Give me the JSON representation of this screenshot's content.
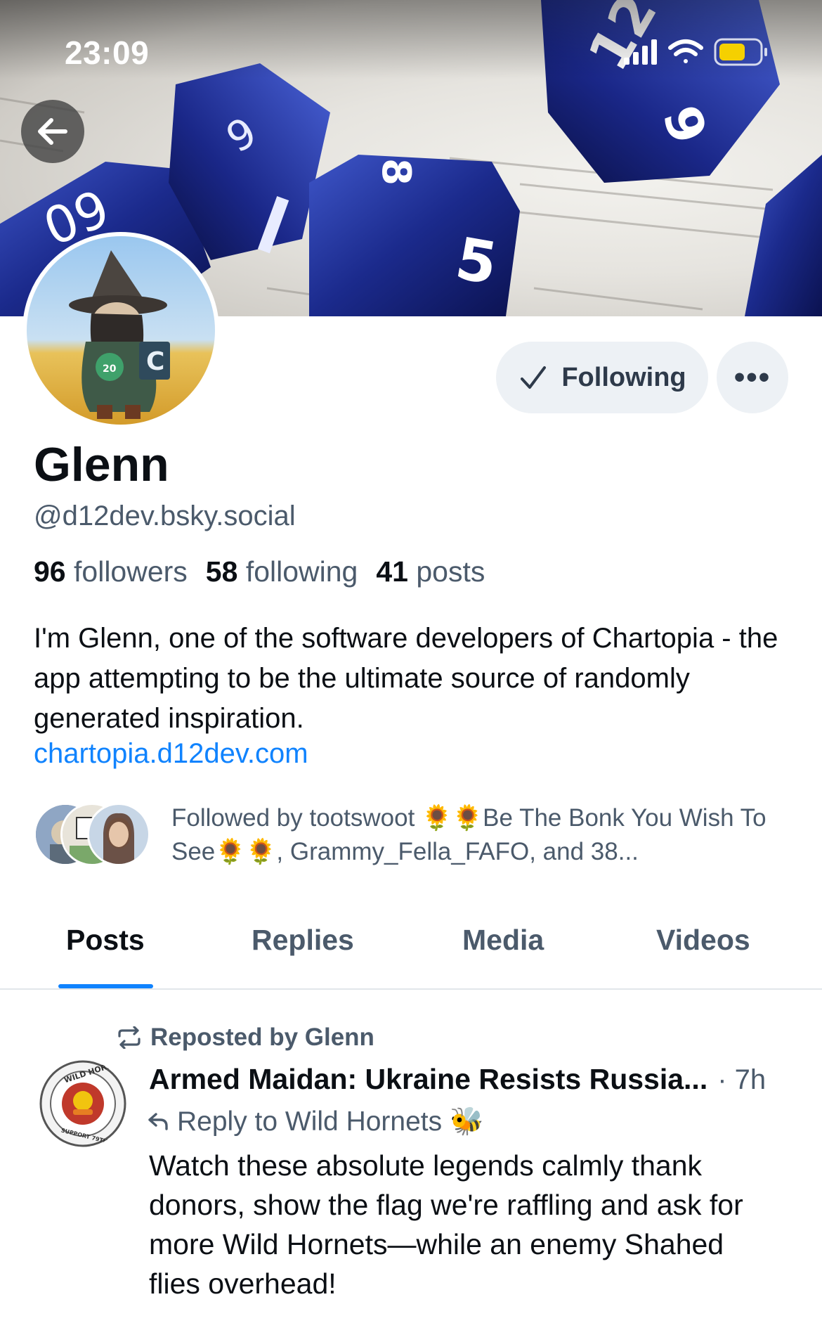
{
  "status_bar": {
    "time": "23:09"
  },
  "profile": {
    "display_name": "Glenn",
    "handle": "@d12dev.bsky.social",
    "following_button_label": "Following",
    "more_button_label": "•••",
    "stats": {
      "followers_count": "96",
      "followers_label": "followers",
      "following_count": "58",
      "following_label": "following",
      "posts_count": "41",
      "posts_label": "posts"
    },
    "bio": "I'm Glenn, one of the software developers of Chartopia - the app attempting to be the ultimate source of randomly generated inspiration.",
    "link": "chartopia.d12dev.com",
    "followed_by": "Followed by tootswoot 🌻🌻Be The Bonk You Wish To See🌻🌻, Grammy_Fella_FAFO, and 38..."
  },
  "tabs": [
    {
      "label": "Posts",
      "active": true
    },
    {
      "label": "Replies",
      "active": false
    },
    {
      "label": "Media",
      "active": false
    },
    {
      "label": "Videos",
      "active": false
    }
  ],
  "post": {
    "repost_label": "Reposted by Glenn",
    "author": "Armed Maidan: Ukraine Resists Russia...",
    "time": "· 7h",
    "reply_to": "Reply to Wild Hornets 🐝",
    "text": "Watch these absolute legends calmly thank donors, show the flag we're raffling and ask for more Wild Hornets—while an enemy Shahed flies overhead!",
    "avatar_text": "WILD HORNETS · SUPPORT 79TH BRIGADE"
  },
  "colors": {
    "accent": "#1083fe",
    "muted_text": "#4b5a6b",
    "button_bg": "#edf1f5",
    "dice_blue": "#1b2a8c"
  },
  "icons": {
    "back": "arrow-left-icon",
    "check": "check-icon",
    "repost": "repost-icon",
    "reply": "reply-arrow-icon",
    "signal": "cellular-signal-icon",
    "wifi": "wifi-icon",
    "battery": "battery-icon"
  }
}
